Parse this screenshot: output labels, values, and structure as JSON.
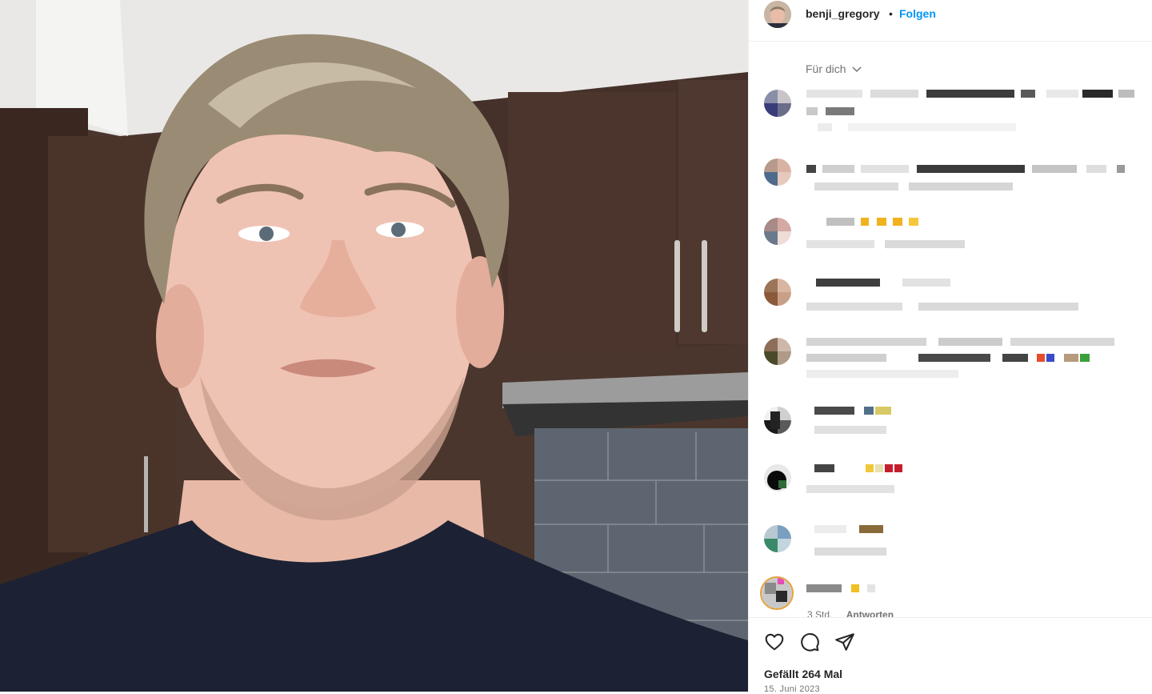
{
  "post": {
    "username": "benji_gregory",
    "separator": "•",
    "follow_label": "Folgen"
  },
  "comments_filter": {
    "label": "Für dich",
    "icon": "chevron-down-icon"
  },
  "last_comment": {
    "time": "3 Std.",
    "reply_label": "Antworten"
  },
  "actions": {
    "like_icon": "heart-icon",
    "comment_icon": "comment-icon",
    "share_icon": "send-icon"
  },
  "likes_text": "Gefällt 264 Mal",
  "date_text": "15. Juni 2023",
  "colors": {
    "accent": "#0095f6",
    "text": "#262626",
    "muted": "#737373",
    "divider": "#efefef"
  }
}
